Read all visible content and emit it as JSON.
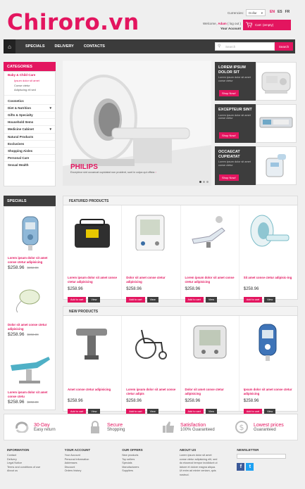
{
  "brand": {
    "name": "Chiroro.vn",
    "accent": "#e3155f",
    "dark": "#3d3d3d"
  },
  "topbar": {
    "currency_label": "Currencies:",
    "currency_value": "Dollar",
    "languages": [
      "EN",
      "ES",
      "FR"
    ],
    "welcome": "Welcome,",
    "user": "Adam",
    "logout": "( log out )",
    "account": "Your Account",
    "cart": "Cart: (empty)"
  },
  "nav": {
    "home_icon": "home-icon",
    "items": [
      "SPECIALS",
      "DELIVERY",
      "CONTACTS"
    ]
  },
  "search": {
    "placeholder": "Search",
    "button": "Search"
  },
  "categories": {
    "title": "CATEGORIES",
    "first": "Baby & Child Care",
    "subs": [
      "Ipsum dolor sit amet",
      "Conse ctetur",
      "Adipiscing eli sed"
    ],
    "items": [
      "Cosmetics",
      "Diet & Nutrition",
      "Gifts & Specialty",
      "Household Items",
      "Medicine Cabinet",
      "Natural Products",
      "Exclusives",
      "Shopping Aisles",
      "Personal Care",
      "Sexual Health"
    ]
  },
  "slider": {
    "brand": "PHILIPS",
    "caption": "Excepteur sint occaecat cupidatat non proident, sunt in culpa qui officia"
  },
  "promos": [
    {
      "title": "LOREM IPSUM DOLOR SIT",
      "desc": "Lorem ipsum dolor sit amet conse ctetur",
      "button": "Shop Now!"
    },
    {
      "title": "EXCEPTEUR SINT",
      "desc": "Lorem ipsum dolor sit amet conse ctetur",
      "button": "Shop Now!"
    },
    {
      "title": "OCCAECAT CUPIDATAT",
      "desc": "Lorem ipsum dolor sit amet conse ctetur",
      "button": "Shop Now!"
    }
  ],
  "specials": {
    "title": "SPECIALS",
    "items": [
      {
        "name": "Lorem ipsum dolor sit amet conse ctetur adipisicing",
        "price": "$258.96",
        "old": "$302.89"
      },
      {
        "name": "Dolor sit amet conse ctetur adipisicing",
        "price": "$258.96",
        "old": "$302.89"
      },
      {
        "name": "Lorem ipsum dolor sit amet conse ctetu",
        "price": "$258.96",
        "old": "$302.89"
      }
    ]
  },
  "featured": {
    "title": "FEATURED PRODUCTS",
    "items": [
      {
        "name": "Lorem ipsum dolor sit amet conse ctetur adipisicing",
        "price": "$258.96"
      },
      {
        "name": "Dolor sit amet conse ctetur adipisicing",
        "price": "$258.96"
      },
      {
        "name": "Lorem ipsum dolor sit amet conse ctetur adipisicing",
        "price": "$258.96"
      },
      {
        "name": "Sit amet conse ctetur adipisic-ing",
        "price": "$258.96"
      }
    ]
  },
  "newp": {
    "title": "NEW PRODUCTS",
    "items": [
      {
        "name": "Amet conse ctetur adipisicing",
        "price": "$258.96"
      },
      {
        "name": "Lorem ipsum dolor sit amet conse ctetur adipis",
        "price": "$258.96"
      },
      {
        "name": "Dolor sit amet conse ctetur adipisicing",
        "price": "$258.96"
      },
      {
        "name": "Ipsum dolor sit amet conse ctetur adipisicing",
        "price": "$258.96"
      }
    ]
  },
  "buttons": {
    "add": "Add to cart",
    "view": "View"
  },
  "features": [
    {
      "t1": "30-Day",
      "t2": "Easy return",
      "icon": "return-icon"
    },
    {
      "t1": "Secure",
      "t2": "Shopping",
      "icon": "lock-icon"
    },
    {
      "t1": "Satisfaction",
      "t2": "100% Guaranteed",
      "icon": "thumbs-up-icon"
    },
    {
      "t1": "Lowest prices",
      "t2": "Guaranteed",
      "icon": "dollar-icon"
    }
  ],
  "footer": {
    "info": {
      "title": "INFORMATION",
      "links": [
        "Contact",
        "Delivery",
        "Legal Notice",
        "Terms and conditions of use",
        "About us"
      ]
    },
    "account": {
      "title": "YOUR ACCOUNT",
      "links": [
        "Your Account",
        "Personal information",
        "Addresses",
        "Discount",
        "Orders history"
      ]
    },
    "offers": {
      "title": "OUR OFFERS",
      "links": [
        "New products",
        "Top sellers",
        "Specials",
        "Manufacturers",
        "Suppliers"
      ]
    },
    "about": {
      "title": "ABOUT US",
      "text": [
        "Lorem ipsum dolor sit amet",
        "conse ctetur adipisicing elit, sed",
        "do eiusmod tempor incididunt ut",
        "labore et dolore magna aliqua.",
        "Ut enim ad minim veniam, quis",
        "nostrud."
      ]
    },
    "newsletter": {
      "title": "NEWSLETTER"
    }
  }
}
